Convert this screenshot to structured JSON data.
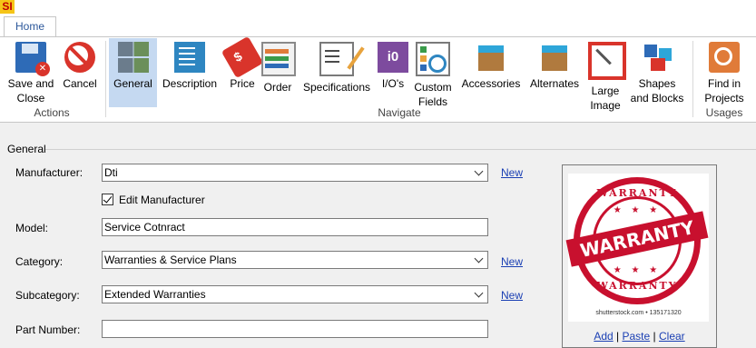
{
  "app": {
    "logo": "SI"
  },
  "ribbon": {
    "tab": "Home",
    "groups": {
      "actions": "Actions",
      "navigate": "Navigate",
      "usages": "Usages"
    },
    "buttons": {
      "save_close_1": "Save and",
      "save_close_2": "Close",
      "cancel": "Cancel",
      "general": "General",
      "description": "Description",
      "price": "Price",
      "order": "Order",
      "specifications": "Specifications",
      "ios": "I/O's",
      "custom_1": "Custom",
      "custom_2": "Fields",
      "accessories": "Accessories",
      "alternates": "Alternates",
      "large_1": "Large",
      "large_2": "Image",
      "shapes_1": "Shapes",
      "shapes_2": "and Blocks",
      "find_1": "Find in",
      "find_2": "Projects"
    },
    "io_icon_text": "i0"
  },
  "form": {
    "section": "General",
    "manufacturer": {
      "label": "Manufacturer:",
      "value": "Dti",
      "link": "New"
    },
    "edit_manufacturer": {
      "label": "Edit Manufacturer",
      "checked": true
    },
    "model": {
      "label": "Model:",
      "value": "Service Cotnract"
    },
    "category": {
      "label": "Category:",
      "value": "Warranties & Service Plans",
      "link": "New"
    },
    "subcategory": {
      "label": "Subcategory:",
      "value": "Extended Warranties",
      "link": "New"
    },
    "part_number": {
      "label": "Part Number:",
      "value": ""
    }
  },
  "image_panel": {
    "stamp_top": "WARRANTY",
    "stamp_center": "WARRANTY",
    "stamp_bottom": "WARRANTY",
    "stars": "★ ★ ★",
    "watermark": "shutterstock.com • 135171320",
    "add": "Add",
    "sep": "|",
    "paste": "Paste",
    "clear": "Clear"
  },
  "colors": {
    "accent": "#2b579a",
    "selected": "#c5d9f1",
    "link": "#1a3fb3",
    "stamp": "#c8102e"
  }
}
